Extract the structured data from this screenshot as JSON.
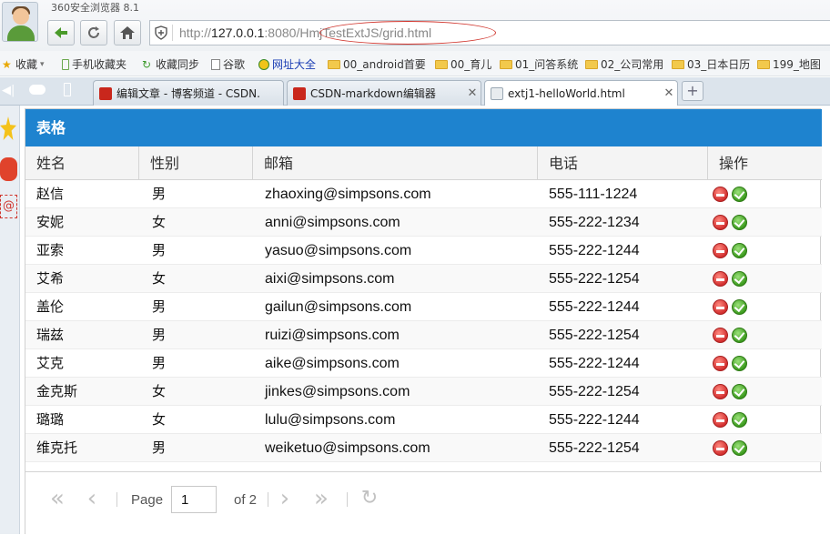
{
  "browser": {
    "app_title": "360安全浏览器 8.1",
    "url_host": "127.0.0.1",
    "url_scheme": "http://",
    "url_port": ":8080/",
    "url_path": "HmjTestExtJS/grid.html"
  },
  "bookmarks": [
    {
      "label": "收藏",
      "icon": "star-icon"
    },
    {
      "label": "手机收藏夹",
      "icon": "phone-icon"
    },
    {
      "label": "收藏同步",
      "icon": "sync-icon"
    },
    {
      "label": "谷歌",
      "icon": "page-icon"
    },
    {
      "label": "网址大全",
      "icon": "globe-icon"
    },
    {
      "label": "00_android首要",
      "icon": "folder-icon"
    },
    {
      "label": "00_育儿",
      "icon": "folder-icon"
    },
    {
      "label": "01_问答系统",
      "icon": "folder-icon"
    },
    {
      "label": "02_公司常用",
      "icon": "folder-icon"
    },
    {
      "label": "03_日本日历",
      "icon": "folder-icon"
    },
    {
      "label": "199_地图",
      "icon": "folder-icon"
    }
  ],
  "tabs": [
    {
      "label": "编辑文章 - 博客频道 - CSDN.",
      "icon_color": "#c9271c"
    },
    {
      "label": "CSDN-markdown编辑器",
      "icon_color": "#c9271c"
    },
    {
      "label": "extj1-helloWorld.html",
      "icon_color": "#9aa7b3"
    }
  ],
  "grid": {
    "title": "表格",
    "columns": [
      "姓名",
      "性别",
      "邮箱",
      "电话",
      "操作"
    ],
    "rows": [
      {
        "name": "赵信",
        "gender": "男",
        "email": "zhaoxing@simpsons.com",
        "phone": "555-111-1224"
      },
      {
        "name": "安妮",
        "gender": "女",
        "email": "anni@simpsons.com",
        "phone": "555-222-1234"
      },
      {
        "name": "亚索",
        "gender": "男",
        "email": "yasuo@simpsons.com",
        "phone": "555-222-1244"
      },
      {
        "name": "艾希",
        "gender": "女",
        "email": "aixi@simpsons.com",
        "phone": "555-222-1254"
      },
      {
        "name": "盖伦",
        "gender": "男",
        "email": "gailun@simpsons.com",
        "phone": "555-222-1244"
      },
      {
        "name": "瑞兹",
        "gender": "男",
        "email": "ruizi@simpsons.com",
        "phone": "555-222-1254"
      },
      {
        "name": "艾克",
        "gender": "男",
        "email": "aike@simpsons.com",
        "phone": "555-222-1244"
      },
      {
        "name": "金克斯",
        "gender": "女",
        "email": "jinkes@simpsons.com",
        "phone": "555-222-1254"
      },
      {
        "name": "璐璐",
        "gender": "女",
        "email": "lulu@simpsons.com",
        "phone": "555-222-1244"
      },
      {
        "name": "维克托",
        "gender": "男",
        "email": "weiketuo@simpsons.com",
        "phone": "555-222-1254"
      }
    ],
    "header_color": "#1e83cf"
  },
  "pager": {
    "page_label": "Page",
    "page_value": "1",
    "of_label": "of 2"
  }
}
